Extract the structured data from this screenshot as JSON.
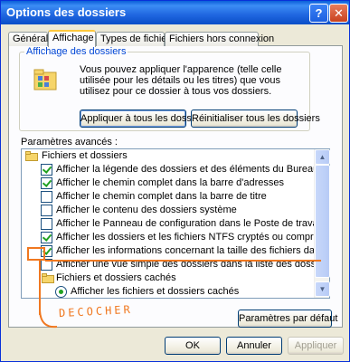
{
  "window": {
    "title": "Options des dossiers",
    "help_label": "?",
    "close_label": "✕"
  },
  "tabs": [
    {
      "label": "Général",
      "active": false
    },
    {
      "label": "Affichage",
      "active": true
    },
    {
      "label": "Types de fichiers",
      "active": false
    },
    {
      "label": "Fichiers hors connexion",
      "active": false
    }
  ],
  "folder_views": {
    "title": "Affichage des dossiers",
    "description": "Vous pouvez appliquer l'apparence (telle celle utilisée pour les détails ou les titres) que vous utilisez pour ce dossier à tous vos dossiers.",
    "apply_all_button": "Appliquer à tous les dossiers",
    "reset_all_button": "Réinitialiser tous les dossiers"
  },
  "advanced": {
    "label": "Paramètres avancés :",
    "items": [
      {
        "type": "folder",
        "label": "Fichiers et dossiers",
        "indent": 0
      },
      {
        "type": "checkbox",
        "checked": true,
        "label": "Afficher la légende des dossiers et des éléments du Bureau",
        "indent": 1
      },
      {
        "type": "checkbox",
        "checked": true,
        "label": "Afficher le chemin complet dans la barre d'adresses",
        "indent": 1
      },
      {
        "type": "checkbox",
        "checked": false,
        "label": "Afficher le chemin complet dans la barre de titre",
        "indent": 1
      },
      {
        "type": "checkbox",
        "checked": false,
        "label": "Afficher le contenu des dossiers système",
        "indent": 1
      },
      {
        "type": "checkbox",
        "checked": false,
        "label": "Afficher le Panneau de configuration dans le Poste de travail",
        "indent": 1
      },
      {
        "type": "checkbox",
        "checked": true,
        "label": "Afficher les dossiers et les fichiers NTFS cryptés ou compressés en coule",
        "indent": 1
      },
      {
        "type": "checkbox",
        "checked": true,
        "label": "Afficher les informations concernant la taille des fichiers dans les info-bulle",
        "indent": 1
      },
      {
        "type": "checkbox",
        "checked": false,
        "label": "Afficher une vue simple des dossiers dans la liste des dossiers de l'Explora",
        "indent": 1
      },
      {
        "type": "folder",
        "label": "Fichiers et dossiers cachés",
        "indent": 1
      },
      {
        "type": "radio",
        "checked": true,
        "label": "Afficher les fichiers et dossiers cachés",
        "indent": 2
      }
    ],
    "defaults_button": "Paramètres par défaut"
  },
  "annotation": {
    "text": "DECOCHER",
    "color": "#f07820"
  },
  "footer": {
    "ok": "OK",
    "cancel": "Annuler",
    "apply": "Appliquer"
  },
  "colors": {
    "title_bar": "#0a5fd8",
    "group_title": "#0046d5",
    "check": "#21a121"
  }
}
